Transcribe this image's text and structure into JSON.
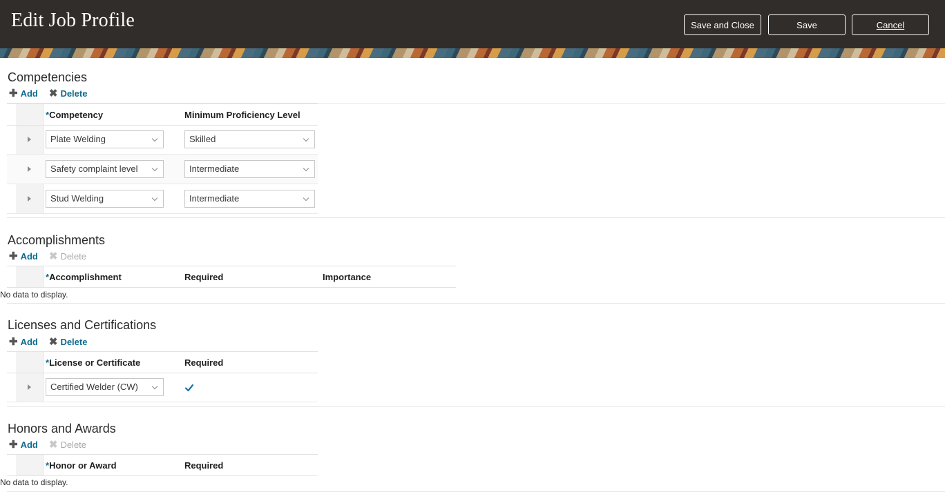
{
  "header": {
    "title": "Edit Job Profile",
    "buttons": {
      "save_close": "Save and Close",
      "save": "Save",
      "cancel": "Cancel"
    }
  },
  "toolbar": {
    "add": "Add",
    "delete": "Delete"
  },
  "competencies": {
    "title": "Competencies",
    "columns": {
      "competency": "Competency",
      "level": "Minimum Proficiency Level"
    },
    "rows": [
      {
        "competency": "Plate Welding",
        "level": "Skilled"
      },
      {
        "competency": "Safety complaint level",
        "level": "Intermediate"
      },
      {
        "competency": "Stud Welding",
        "level": "Intermediate"
      }
    ]
  },
  "accomplishments": {
    "title": "Accomplishments",
    "columns": {
      "accomplishment": "Accomplishment",
      "required": "Required",
      "importance": "Importance"
    },
    "empty": "No data to display."
  },
  "licenses": {
    "title": "Licenses and Certifications",
    "columns": {
      "license": "License or Certificate",
      "required": "Required"
    },
    "rows": [
      {
        "license": "Certified Welder (CW)",
        "required": true
      }
    ]
  },
  "honors": {
    "title": "Honors and Awards",
    "columns": {
      "honor": "Honor or Award",
      "required": "Required"
    },
    "empty": "No data to display."
  },
  "required_marker": "*",
  "colors": {
    "header_bg": "#312d2a",
    "link": "#0d6b8f",
    "check": "#1a72a8"
  }
}
